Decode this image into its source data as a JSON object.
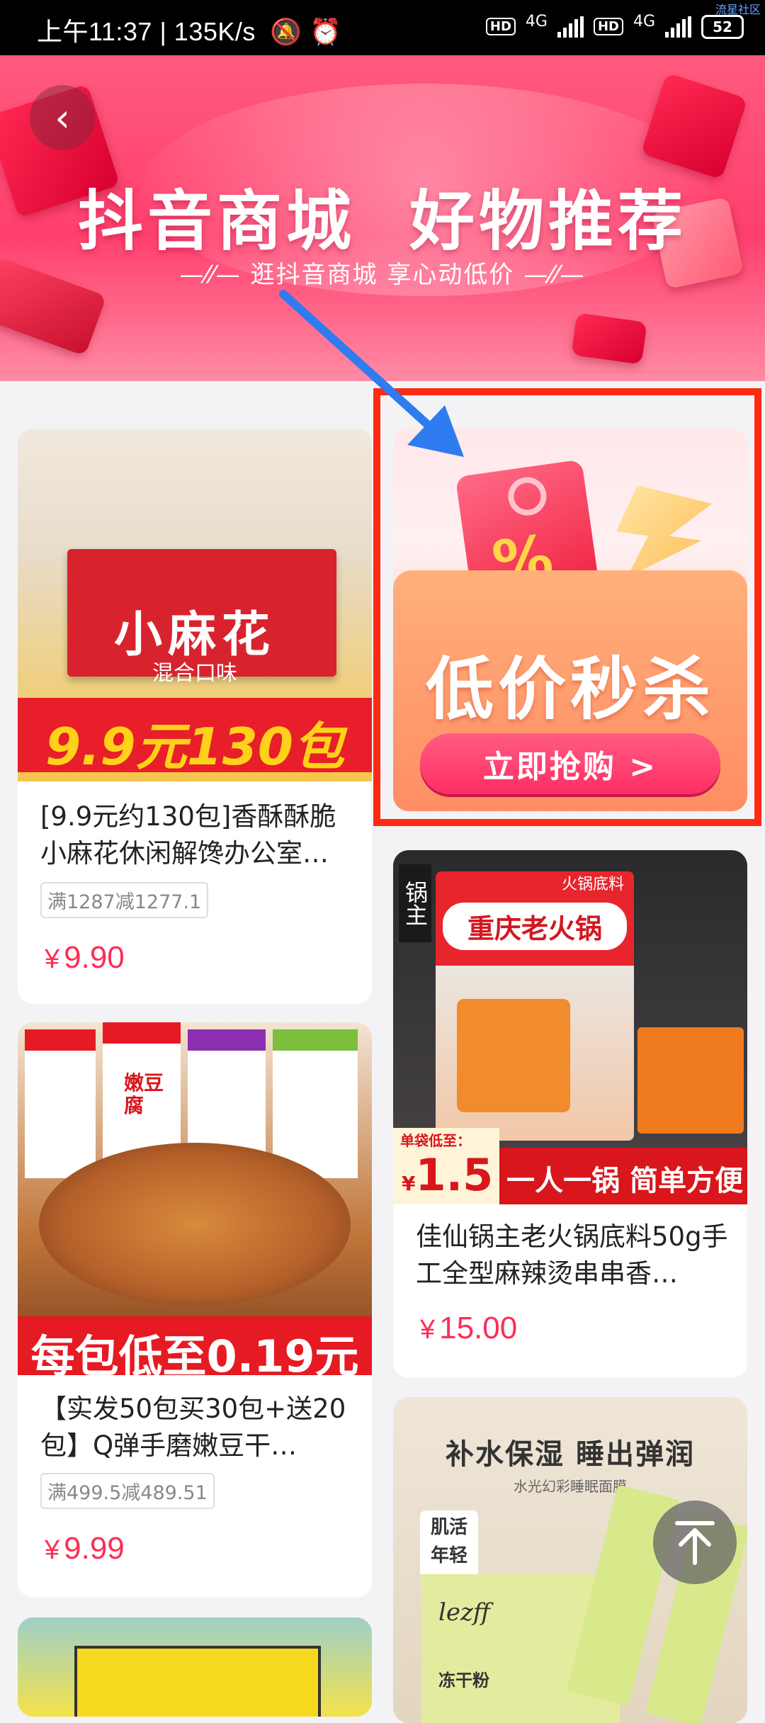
{
  "status_bar": {
    "time": "上午11:37",
    "speed": "135K/s",
    "network1": "4G",
    "network2": "4G",
    "battery": "52",
    "hd": "HD"
  },
  "watermark": "流星社区",
  "banner": {
    "title": "抖音商城  好物推荐",
    "subtitle": "—⁄⁄— 逛抖音商城 享心动低价 —⁄⁄—"
  },
  "flash_sale": {
    "title": "低价秒杀",
    "button": "立即抢购 >"
  },
  "products": [
    {
      "image_text_main": "小麻花",
      "image_text_sub": "混合口味",
      "image_banner": "9.9元130包",
      "title": "[9.9元约130包]香酥酥脆小麻花休闲解馋办公室…",
      "tag": "满1287减1277.1",
      "currency": "¥",
      "price": "9.90"
    },
    {
      "image_text_main": "重庆老火锅",
      "image_text_top": "火锅底料",
      "image_text_side": "锅主",
      "image_banner_label": "单袋低至：",
      "image_banner_price": "1.5",
      "image_banner_slogan": "一人一锅 简单方便",
      "title": "佳仙锅主老火锅底料50g手工全型麻辣烫串串香…",
      "currency": "¥",
      "price": "15.00"
    },
    {
      "image_banner": "每包低至0.19元",
      "image_label": "嫩豆腐",
      "title": "【实发50包买30包+送20包】Q弹手磨嫩豆干…",
      "tag": "满499.5减489.51",
      "currency": "¥",
      "price": "9.99"
    },
    {
      "image_headline": "补水保湿 睡出弹润",
      "image_sub": "水光幻彩睡眠面膜",
      "image_badge": "肌活年轻",
      "image_brand": "lezff",
      "image_product": "冻干粉"
    }
  ],
  "colors": {
    "accent": "#ff2d55",
    "highlight_box": "#ff2a14",
    "arrow": "#2f7bf0"
  }
}
